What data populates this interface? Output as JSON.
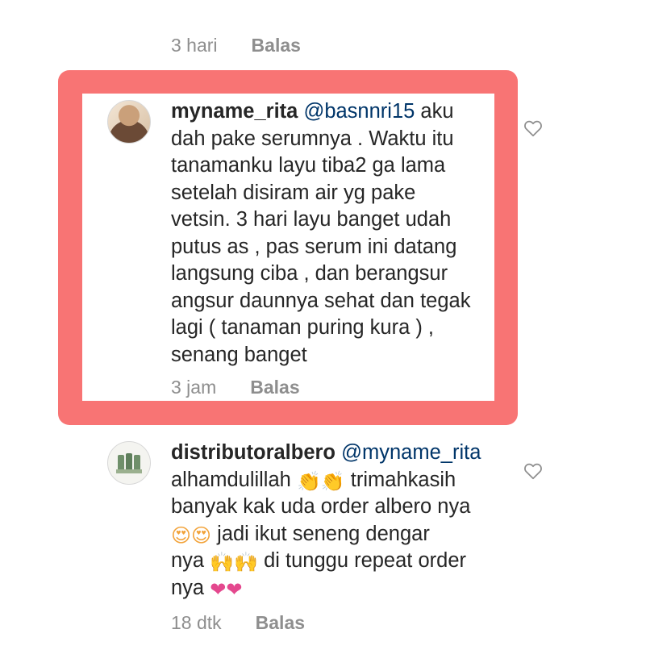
{
  "top_comment_meta": {
    "time": "3 hari",
    "reply_label": "Balas"
  },
  "comments": [
    {
      "username": "myname_rita",
      "mention": "@basnnri15",
      "lines": [
        " aku",
        "dah pake serumnya . Waktu itu",
        "tanamanku layu tiba2 ga lama",
        "setelah disiram air yg pake",
        "vetsin.  3 hari layu banget udah",
        "putus as , pas serum ini datang",
        "langsung ciba , dan berangsur",
        "angsur daunnya sehat dan tegak",
        "lagi ( tanaman puring kura ) ,",
        "senang banget"
      ],
      "time": "3 jam",
      "reply_label": "Balas",
      "highlighted": true,
      "highlight_color": "#f87474"
    },
    {
      "username": "distributoralbero",
      "mention": "@myname_rita",
      "line1": "alhamdulillah ",
      "line1_after": " trimahkasih",
      "line2": "banyak kak uda order albero nya",
      "line3_after": " jadi ikut seneng dengar",
      "line4_before": "nya ",
      "line4_after": " di tunggu repeat order",
      "line5_before": "nya ",
      "time": "18 dtk",
      "reply_label": "Balas",
      "emojis": {
        "clap": "👏",
        "heart_eyes": "😍",
        "raised_hands": "🙌",
        "pink_heart": "❤"
      }
    }
  ],
  "colors": {
    "text": "#262626",
    "meta": "#8e8e8e",
    "mention": "#003569",
    "highlight": "#f87474"
  }
}
